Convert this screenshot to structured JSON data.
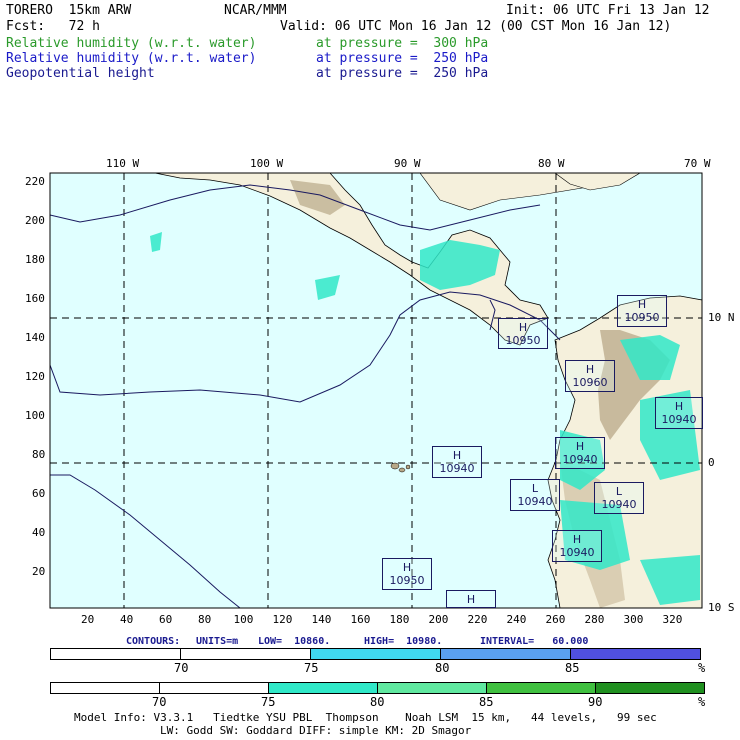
{
  "header": {
    "model_name": "TORERO  15km ARW",
    "institution": "NCAR/MMM",
    "init": "Init: 06 UTC Fri 13 Jan 12",
    "fcst": "Fcst:   72 h",
    "valid": "Valid: 06 UTC Mon 16 Jan 12 (00 CST Mon 16 Jan 12)"
  },
  "fields": [
    {
      "name": "Relative humidity (w.r.t. water)",
      "level": "at pressure =  300 hPa",
      "color": "#2a9a2a"
    },
    {
      "name": "Relative humidity (w.r.t. water)",
      "level": "at pressure =  250 hPa",
      "color": "#1a1ac8"
    },
    {
      "name": "Geopotential height",
      "level": "at pressure =  250 hPa",
      "color": "#1a1a90"
    }
  ],
  "map": {
    "top_lon_labels": [
      "110 W",
      "100 W",
      "90 W",
      "80 W",
      "70 W"
    ],
    "right_lat_labels": [
      "10 N",
      "0",
      "10 S"
    ],
    "left_y_labels": [
      "220",
      "200",
      "180",
      "160",
      "140",
      "120",
      "100",
      "80",
      "60",
      "40",
      "20"
    ],
    "bottom_x_labels": [
      "20",
      "40",
      "60",
      "80",
      "100",
      "120",
      "140",
      "160",
      "180",
      "200",
      "220",
      "240",
      "260",
      "280",
      "300",
      "320"
    ],
    "centers": [
      {
        "letter": "H",
        "value": "10950"
      },
      {
        "letter": "H",
        "value": "10950"
      },
      {
        "letter": "H",
        "value": "10960"
      },
      {
        "letter": "H",
        "value": "10940"
      },
      {
        "letter": "H",
        "value": "10940"
      },
      {
        "letter": "H",
        "value": "10940"
      },
      {
        "letter": "L",
        "value": "10940"
      },
      {
        "letter": "L",
        "value": "10940"
      },
      {
        "letter": "H",
        "value": "10940"
      },
      {
        "letter": "H",
        "value": "10950"
      },
      {
        "letter": "H",
        "value": ""
      }
    ],
    "colors": {
      "ocean": "#e0ffff",
      "land": "#f5f0dc",
      "terrain": "#b8a888",
      "height_contour": "#1a1a60"
    }
  },
  "contour_info": {
    "contours_label": "CONTOURS:",
    "units": "UNITS=m",
    "low": "LOW=  10860.",
    "high": "HIGH=  10980.",
    "interval": "INTERVAL=   60.000"
  },
  "colorbar_250": {
    "labels": [
      "70",
      "75",
      "80",
      "85",
      "%"
    ],
    "colors": [
      "#ffffff",
      "#ffffff",
      "#40d8f0",
      "#5aa0f0",
      "#5050e0"
    ]
  },
  "colorbar_300": {
    "labels": [
      "70",
      "75",
      "80",
      "85",
      "90",
      "%"
    ],
    "colors": [
      "#ffffff",
      "#ffffff",
      "#30e8c8",
      "#60e8a0",
      "#40c040",
      "#209020"
    ]
  },
  "footer": {
    "line1": "Model Info: V3.3.1   Tiedtke YSU PBL  Thompson    Noah LSM  15 km,   44 levels,   99 sec",
    "line2": "LW: Godd SW: Goddard DIFF: simple KM: 2D Smagor"
  }
}
